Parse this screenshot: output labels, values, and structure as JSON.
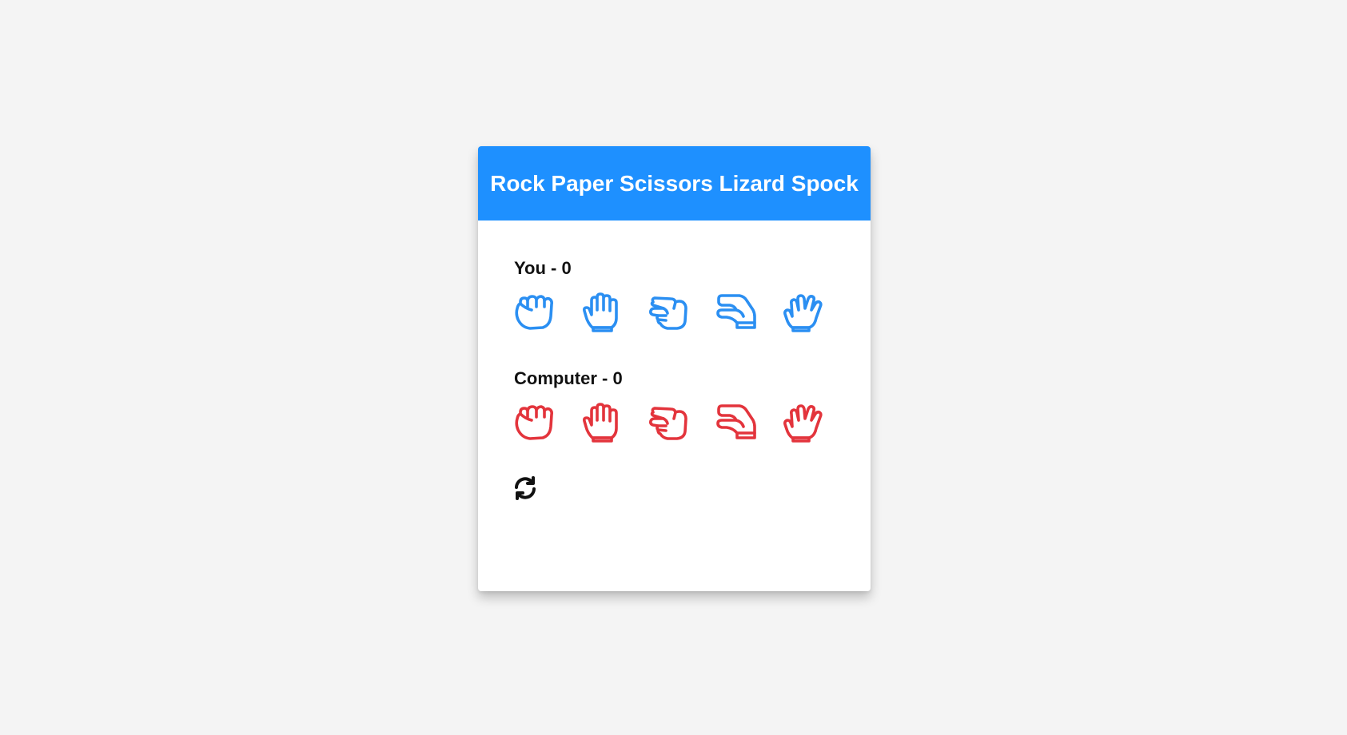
{
  "header": {
    "title": "Rock Paper Scissors Lizard Spock"
  },
  "players": {
    "you": {
      "label": "You - 0",
      "color": "#2b8ff2"
    },
    "computer": {
      "label": "Computer - 0",
      "color": "#e3343c"
    }
  },
  "choices": [
    {
      "id": "rock",
      "icon": "hand-rock-icon"
    },
    {
      "id": "paper",
      "icon": "hand-paper-icon"
    },
    {
      "id": "scissors",
      "icon": "hand-scissors-icon"
    },
    {
      "id": "lizard",
      "icon": "hand-lizard-icon"
    },
    {
      "id": "spock",
      "icon": "hand-spock-icon"
    }
  ],
  "reset": {
    "icon": "refresh-icon"
  },
  "colors": {
    "accent": "#1e90ff",
    "background": "#f4f4f4",
    "card": "#ffffff"
  }
}
